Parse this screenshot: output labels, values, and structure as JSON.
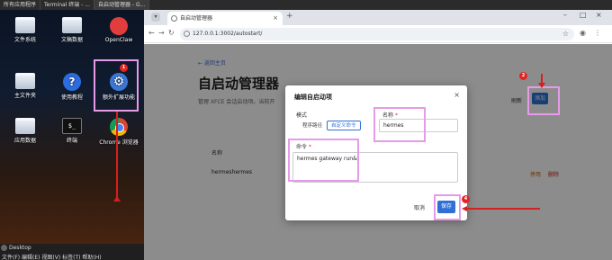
{
  "top_panel": {
    "tasks": [
      "所有应用程序",
      "Terminal 终端 - ...",
      "自启动管理器 - G..."
    ]
  },
  "desktop": {
    "icons": [
      {
        "label": "文件系统",
        "icon": "drive-icon"
      },
      {
        "label": "文稿数据",
        "icon": "folder-icon"
      },
      {
        "label": "OpenClaw",
        "icon": "openclaw-icon"
      },
      {
        "label": "主文件夹",
        "icon": "home-folder-icon"
      },
      {
        "label": "使用教程",
        "icon": "help-icon"
      },
      {
        "label": "额外扩展功能",
        "icon": "gear-icon"
      },
      {
        "label": "应用数据",
        "icon": "folder-icon"
      },
      {
        "label": "终端",
        "icon": "terminal-icon"
      },
      {
        "label": "Chrome 浏览器",
        "icon": "chrome-icon"
      }
    ],
    "markers": [
      "1",
      "2",
      "3",
      "4"
    ]
  },
  "bottom_panel": {
    "window_name": "Desktop",
    "menu": "文件(F)  编辑(E)  视图(V)  标签(T)  帮助(H)"
  },
  "browser": {
    "tab_title": "自启动管理器",
    "new_tab": "+",
    "url": "127.0.0.1:3002/autostart/",
    "win_min": "–",
    "win_max": "□",
    "win_close": "×",
    "nav_back": "←",
    "nav_forward": "→",
    "nav_reload": "↻"
  },
  "page": {
    "back_link": "← 返回主页",
    "title": "自启动管理器",
    "description": "管理 XFCE 会话启动项。当前开",
    "refresh": "刷新",
    "add": "添加",
    "table_header_name": "名称",
    "row_name": "hermeshermes",
    "row_actions": [
      "停用",
      "删除"
    ]
  },
  "dialog": {
    "title": "编辑自启动项",
    "close": "×",
    "mode_label": "模式",
    "mode_options": [
      "程序路径",
      "自定义命令"
    ],
    "mode_selected": 1,
    "name_label": "名称",
    "name_value": "hermes",
    "command_label": "命令",
    "command_value": "hermes gateway run&",
    "required_mark": "*",
    "cancel": "取消",
    "save": "保存"
  },
  "colors": {
    "accent": "#2f6fd6",
    "highlight": "#e79ae8",
    "annotation": "#d42020"
  }
}
